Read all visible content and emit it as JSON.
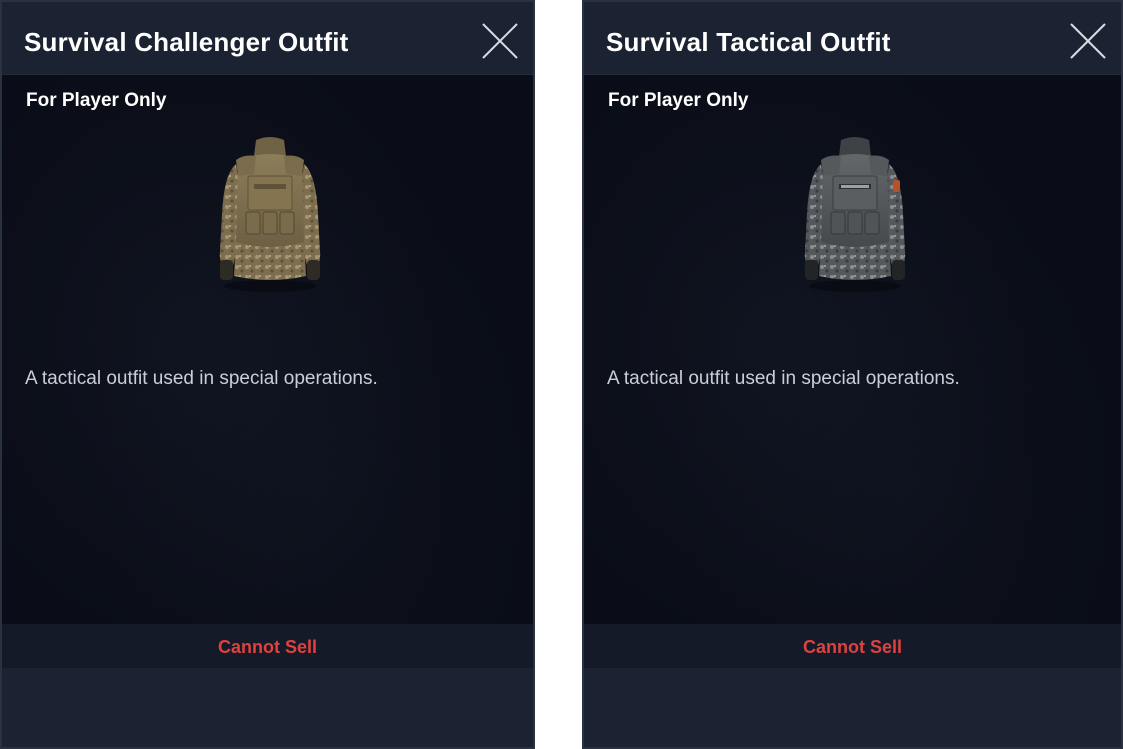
{
  "panels": [
    {
      "title": "Survival Challenger Outfit",
      "subtitle": "For Player Only",
      "description": "A tactical outfit used in special operations.",
      "footer_label": "Cannot Sell",
      "outfit_icon": "camo-tactical-outfit-icon",
      "outfit_color": "#8a7a58"
    },
    {
      "title": "Survival Tactical Outfit",
      "subtitle": "For Player Only",
      "description": "A tactical outfit used in special operations.",
      "footer_label": "Cannot Sell",
      "outfit_icon": "grey-tactical-outfit-icon",
      "outfit_color": "#5a5f63"
    }
  ],
  "colors": {
    "panel_background": "#0a0d17",
    "header_background": "#1b2232",
    "footer_background": "#141a28",
    "warning_text": "#e0413f"
  },
  "icons": {
    "close": "close-icon"
  }
}
